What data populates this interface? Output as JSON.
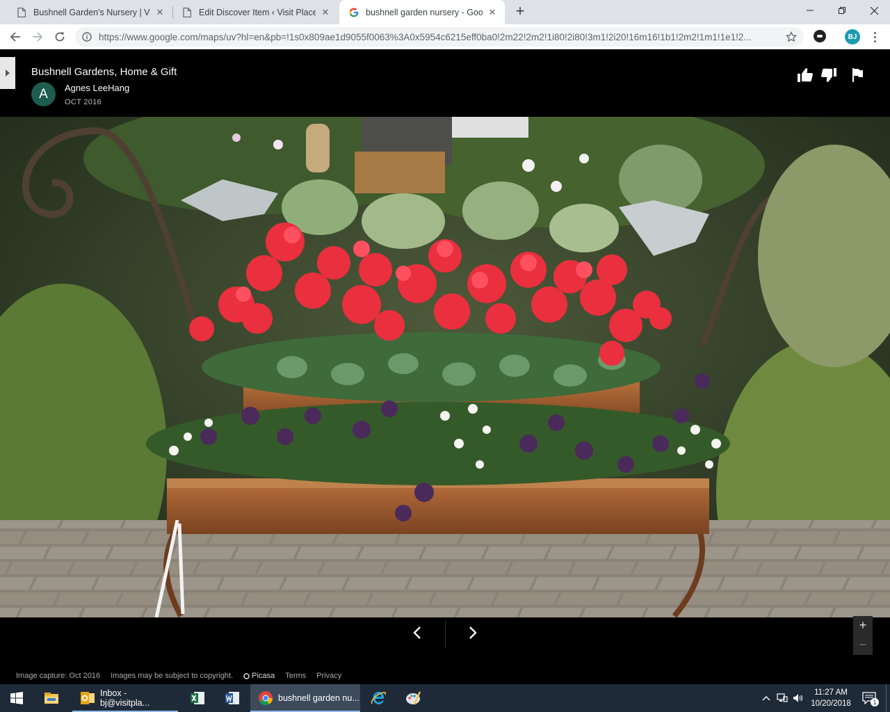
{
  "browser": {
    "tabs": [
      {
        "label": "Bushnell Garden's Nursery | Visit Placer",
        "active": false
      },
      {
        "label": "Edit Discover Item ‹ Visit Placer County",
        "active": false
      },
      {
        "label": "bushnell garden nursery - Google Maps",
        "active": true
      }
    ],
    "url": "https://www.google.com/maps/uv?hl=en&pb=!1s0x809ae1d9055f0063%3A0x5954c6215eff0ba0!2m22!2m2!1i80!2i80!3m1!2i20!16m16!1b1!2m2!1m1!1e1!2...",
    "profile_initials": "BJ"
  },
  "viewer": {
    "place_title": "Bushnell Gardens, Home & Gift",
    "avatar_letter": "A",
    "author": "Agnes LeeHang",
    "date": "OCT 2016",
    "footer": {
      "capture": "Image capture: Oct 2016",
      "copyright": "Images may be subject to copyright.",
      "picasa": "Picasa",
      "terms": "Terms",
      "privacy": "Privacy"
    }
  },
  "taskbar": {
    "apps": [
      {
        "label": "",
        "icon": "file-explorer-icon"
      },
      {
        "label": "Inbox - bj@visitpla...",
        "icon": "outlook-icon"
      },
      {
        "label": "",
        "icon": "excel-icon"
      },
      {
        "label": "",
        "icon": "word-icon"
      },
      {
        "label": "bushnell garden nu...",
        "icon": "chrome-icon"
      },
      {
        "label": "",
        "icon": "internet-explorer-icon"
      },
      {
        "label": "",
        "icon": "paint-icon"
      }
    ],
    "time": "11:27 AM",
    "date": "10/20/2018",
    "notification_count": "1"
  }
}
